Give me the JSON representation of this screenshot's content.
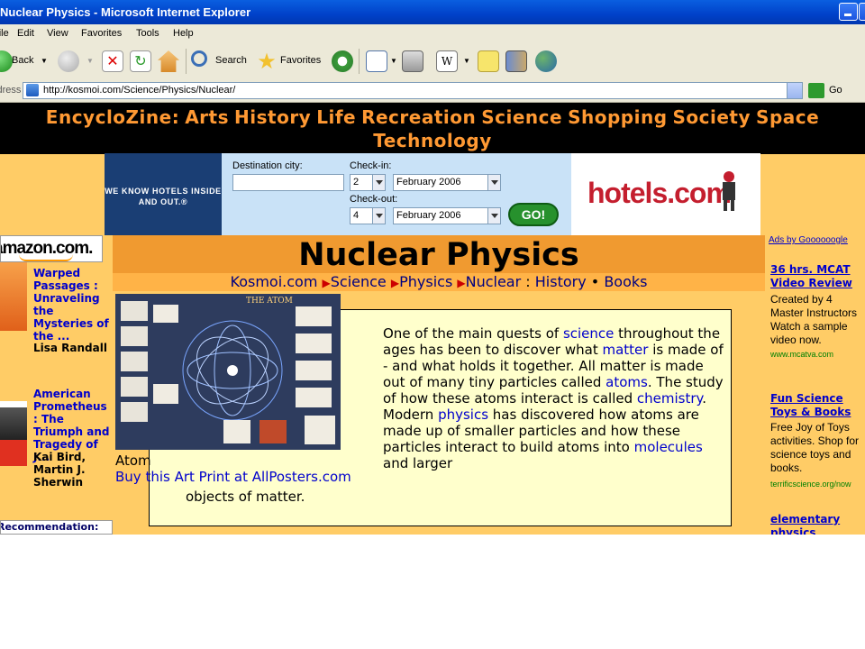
{
  "window": {
    "title": "Nuclear Physics - Microsoft Internet Explorer"
  },
  "menu": [
    "File",
    "Edit",
    "View",
    "Favorites",
    "Tools",
    "Help"
  ],
  "toolbar": {
    "back": "Back",
    "search": "Search",
    "favorites": "Favorites"
  },
  "address": {
    "label": "Address",
    "url": "http://kosmoi.com/Science/Physics/Nuclear/",
    "go": "Go"
  },
  "site_nav": [
    "EncycloZine:",
    "Arts",
    "History",
    "Life",
    "Recreation",
    "Science",
    "Shopping",
    "Society",
    "Space",
    "Technology"
  ],
  "hotels_ad": {
    "slogan": "WE KNOW HOTELS INSIDE AND OUT.®",
    "destination_label": "Destination city:",
    "destination_value": "",
    "checkin_label": "Check-in:",
    "checkin_day": "2",
    "checkin_month": "February 2006",
    "checkout_label": "Check-out:",
    "checkout_day": "4",
    "checkout_month": "February 2006",
    "go": "GO!",
    "logo": "hotels.com"
  },
  "page": {
    "title": "Nuclear Physics",
    "breadcrumb": {
      "home": "Kosmoi.com",
      "science": "Science",
      "physics": "Physics",
      "nuclear": "Nuclear",
      "sep": ":",
      "history": "History",
      "dot": "•",
      "books": "Books"
    }
  },
  "amazon": {
    "logo": "amazon.com.",
    "books": [
      {
        "title": "Warped Passages : Unraveling the Mysteries of the ...",
        "author": "Lisa Randall"
      },
      {
        "title": "American Prometheus : The Triumph and Tragedy of J...",
        "author": "Kai Bird, Martin J. Sherwin"
      }
    ],
    "recommendation": "Recommendation:"
  },
  "art": {
    "caption": "Atom",
    "buy": "Buy this Art Print at AllPosters.com",
    "poster_title": "THE ATOM"
  },
  "body": {
    "p1": "One of the main quests of ",
    "science": "science",
    "p2": " throughout the ages has been to discover what ",
    "matter": "matter",
    "p3": " is made of - and what holds it together. All matter is made out of many tiny particles called ",
    "atoms": "atoms",
    "p4": ". The study of how these atoms interact is called ",
    "chemistry": "chemistry",
    "p5": ". Modern ",
    "physics": "physics",
    "p6": " has discovered how atoms are made up of smaller particles and how these particles interact to build atoms into ",
    "molecules": "molecules",
    "p7": " and larger",
    "tail": "objects of matter."
  },
  "ads": {
    "label": "Ads by Goooooogle",
    "items": [
      {
        "title": "36 hrs. MCAT Video Review",
        "desc": "Created by 4 Master Instructors Watch a sample video now.",
        "url": "www.mcatva.com"
      },
      {
        "title": "Fun Science Toys & Books",
        "desc": "Free Joy of Toys activities. Shop for science toys and books.",
        "url": "terrificscience.org/now"
      },
      {
        "title": "elementary physics",
        "desc": "",
        "url": ""
      }
    ]
  },
  "colors": {
    "nav_bg": "#000000",
    "nav_text": "#ff9933",
    "page_bg": "#ffcc66",
    "title_bar": "#f09a30",
    "content_bg": "#ffffcc",
    "link": "#0000cc"
  }
}
